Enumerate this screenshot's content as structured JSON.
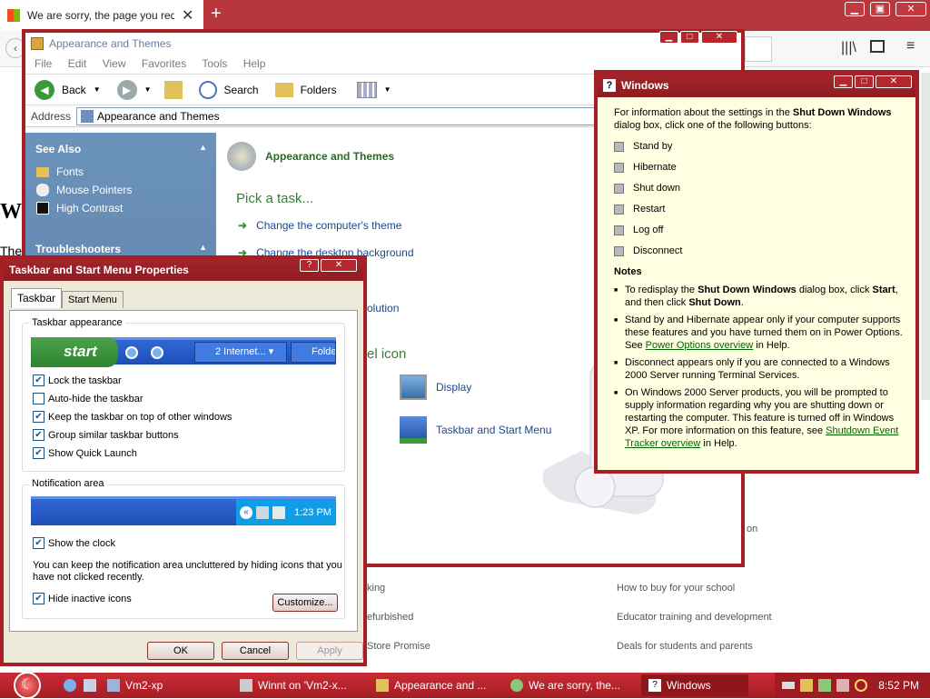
{
  "browser": {
    "tab_title": "We are sorry, the page you requ",
    "page_heading_fragment": "W",
    "page_text_fragment": "The",
    "footer_links": [
      "How to buy for your school",
      "Educator training and development",
      "Deals for students and parents",
      "king",
      "efurbished",
      "Store Promise",
      "on"
    ]
  },
  "xp_window": {
    "title": "Appearance and Themes",
    "menu": [
      "File",
      "Edit",
      "View",
      "Favorites",
      "Tools",
      "Help"
    ],
    "toolbar": {
      "back": "Back",
      "search": "Search",
      "folders": "Folders"
    },
    "address_label": "Address",
    "address_value": "Appearance and Themes",
    "see_also": {
      "title": "See Also",
      "items": [
        "Fonts",
        "Mouse Pointers",
        "High Contrast"
      ]
    },
    "troubleshooters": "Troubleshooters",
    "header": "Appearance and Themes",
    "pick_task": "Pick a task...",
    "tasks": [
      "Change the computer's theme",
      "Change the desktop background"
    ],
    "partial_text": {
      "resolution": "olution",
      "icon_heading": "el icon"
    },
    "icons": [
      "Display",
      "Taskbar and Start Menu"
    ]
  },
  "taskbar_dialog": {
    "title": "Taskbar and Start Menu Properties",
    "tabs": [
      "Taskbar",
      "Start Menu"
    ],
    "appearance_group": "Taskbar appearance",
    "preview": {
      "start": "start",
      "item1": "2 Internet...",
      "item2": "Folde"
    },
    "checkboxes": [
      {
        "label": "Lock the taskbar",
        "checked": true
      },
      {
        "label": "Auto-hide the taskbar",
        "checked": false
      },
      {
        "label": "Keep the taskbar on top of other windows",
        "checked": true
      },
      {
        "label": "Group similar taskbar buttons",
        "checked": true
      },
      {
        "label": "Show Quick Launch",
        "checked": true
      }
    ],
    "notification_group": "Notification area",
    "notification_time": "1:23 PM",
    "show_clock": {
      "label": "Show the clock",
      "checked": true
    },
    "notification_text": "You can keep the notification area uncluttered by hiding icons that you have not clicked recently.",
    "hide_inactive": {
      "label": "Hide inactive icons",
      "checked": true
    },
    "customize": "Customize...",
    "ok": "OK",
    "cancel": "Cancel",
    "apply": "Apply"
  },
  "help_window": {
    "title": "Windows",
    "intro_1": "For information about the settings in the ",
    "intro_bold": "Shut Down Windows",
    "intro_2": " dialog box, click one of the following buttons:",
    "options": [
      "Stand by",
      "Hibernate",
      "Shut down",
      "Restart",
      "Log off",
      "Disconnect"
    ],
    "notes_title": "Notes",
    "note1_a": "To redisplay the ",
    "note1_b": "Shut Down Windows",
    "note1_c": " dialog box, click ",
    "note1_d": "Start",
    "note1_e": ", and then click ",
    "note1_f": "Shut Down",
    "note1_g": ".",
    "note2_a": "Stand by and Hibernate appear only if your computer supports these features and you have turned them on in Power Options. See ",
    "note2_link": "Power Options overview",
    "note2_b": " in Help.",
    "note3": "Disconnect appears only if you are connected to a Windows 2000 Server running Terminal Services.",
    "note4_a": "On Windows 2000 Server products, you will be prompted to supply information regarding why you are shutting down or restarting the computer. This feature is turned off in Windows XP. For more information on this feature, see ",
    "note4_link": "Shutdown Event Tracker overview",
    "note4_b": " in Help."
  },
  "taskbar": {
    "items": [
      "Vm2-xp",
      "Winnt on 'Vm2-x...",
      "Appearance and ...",
      "We are sorry, the...",
      "Windows"
    ],
    "clock": "8:52 PM"
  },
  "colors": {
    "xp_frame": "#a71f25",
    "taskbar": "#b72229",
    "help_bg": "#ffffe1",
    "sidebar": "#5e86ae"
  }
}
